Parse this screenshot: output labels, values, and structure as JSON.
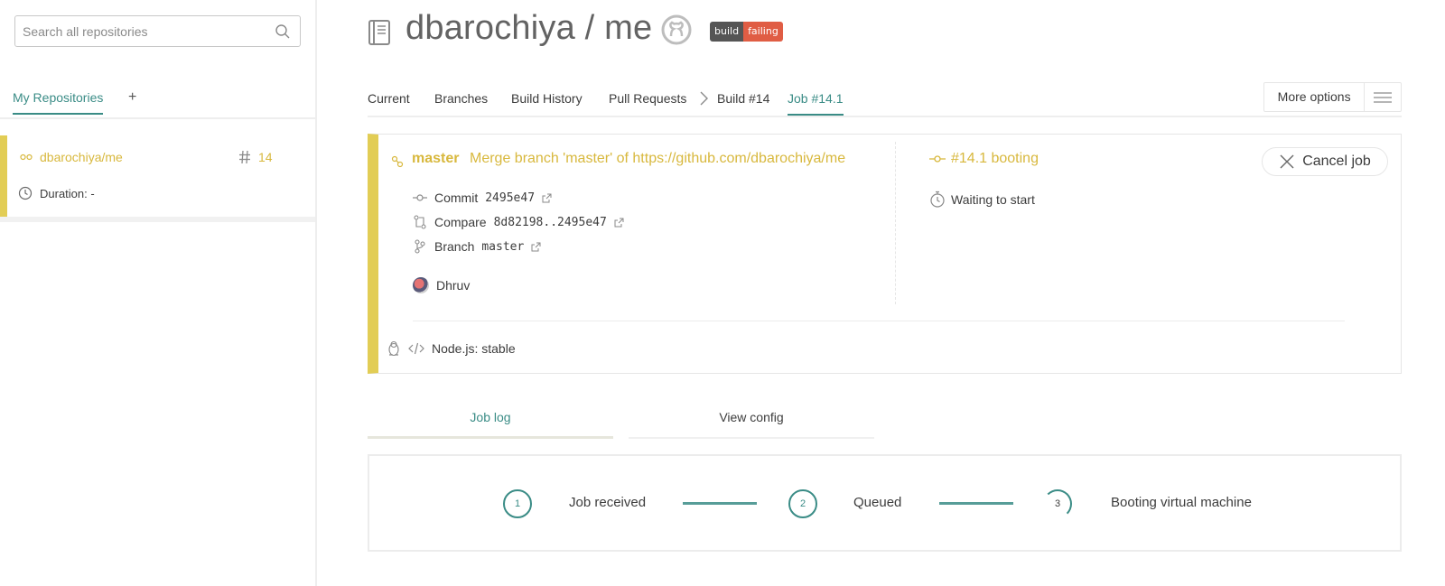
{
  "sidebar": {
    "search_placeholder": "Search all repositories",
    "tabs": {
      "active": "My Repositories",
      "add": "+"
    },
    "repo": {
      "name": "dbarochiya/me",
      "number": "14",
      "duration": "Duration: -"
    }
  },
  "header": {
    "repo_title": "dbarochiya / me",
    "badge": {
      "left": "build",
      "right": "failing"
    }
  },
  "nav": {
    "items": [
      "Current",
      "Branches",
      "Build History",
      "Pull Requests",
      "Build #14",
      "Job #14.1"
    ],
    "more_options": "More options"
  },
  "job": {
    "branch": "master",
    "message": "Merge branch 'master' of https://github.com/dbarochiya/me",
    "commit_label": "Commit",
    "commit_value": "2495e47",
    "compare_label": "Compare",
    "compare_value": "8d82198..2495e47",
    "branch_label": "Branch",
    "branch_value": "master",
    "author": "Dhruv",
    "status": "#14.1 booting",
    "wait": "Waiting to start",
    "cancel": "Cancel job",
    "language": "Node.js: stable"
  },
  "log_tabs": {
    "job_log": "Job log",
    "view_config": "View config"
  },
  "steps": [
    {
      "num": "1",
      "label": "Job received"
    },
    {
      "num": "2",
      "label": "Queued"
    },
    {
      "num": "3",
      "label": "Booting virtual machine"
    }
  ],
  "colors": {
    "accent": "#3a8c86",
    "warning": "#e2cd55",
    "warning_text": "#d8b83d",
    "badge_fail": "#e05d44",
    "badge_label": "#555555"
  },
  "icons": [
    "search-icon",
    "clock-icon",
    "repo-book-icon",
    "github-icon",
    "branch-icon",
    "commit-icon",
    "compare-icon",
    "external-link-icon",
    "stopwatch-icon",
    "close-icon",
    "linux-icon",
    "code-icon",
    "menu-icon",
    "chevron-right-icon"
  ]
}
